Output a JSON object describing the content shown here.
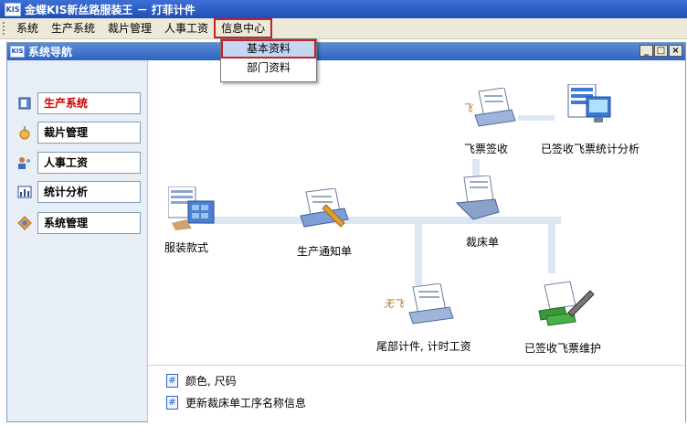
{
  "app": {
    "title": "金蝶KIS新丝路服装王 － 打菲计件",
    "logo_text": "KIS"
  },
  "menubar": {
    "items": [
      "系统",
      "生产系统",
      "裁片管理",
      "人事工资",
      "信息中心"
    ],
    "open_menu": "信息中心"
  },
  "dropdown": {
    "items": [
      "基本资料",
      "部门资料"
    ],
    "selected": "基本资料"
  },
  "child_window": {
    "title": "系统导航",
    "logo_text": "KIS",
    "btn_min": "_",
    "btn_max": "□",
    "btn_close": "×"
  },
  "nav": {
    "items": [
      {
        "label": "生产系统",
        "icon": "book-icon"
      },
      {
        "label": "裁片管理",
        "icon": "cut-icon"
      },
      {
        "label": "人事工资",
        "icon": "people-icon"
      },
      {
        "label": "统计分析",
        "icon": "chart-icon"
      },
      {
        "label": "系统管理",
        "icon": "system-icon"
      }
    ],
    "active": "生产系统"
  },
  "flow": {
    "garment_style": "服装款式",
    "production_notice": "生产通知单",
    "ticket_sign": "飞票签收",
    "signed_stats": "已签收飞票统计分析",
    "cutting_sheet": "裁床单",
    "tail_piece": "尾部计件, 计时工资",
    "signed_maintain": "已签收飞票维护",
    "fei": "飞",
    "wu_fei": "无飞"
  },
  "links": [
    "颜色, 尺码",
    "更新裁床单工序名称信息"
  ],
  "colors": {
    "title_bar": "#1f4fb5",
    "menu_bg": "#ece9d8",
    "nav_bg": "#e8eef6",
    "highlight": "#c0242a"
  }
}
